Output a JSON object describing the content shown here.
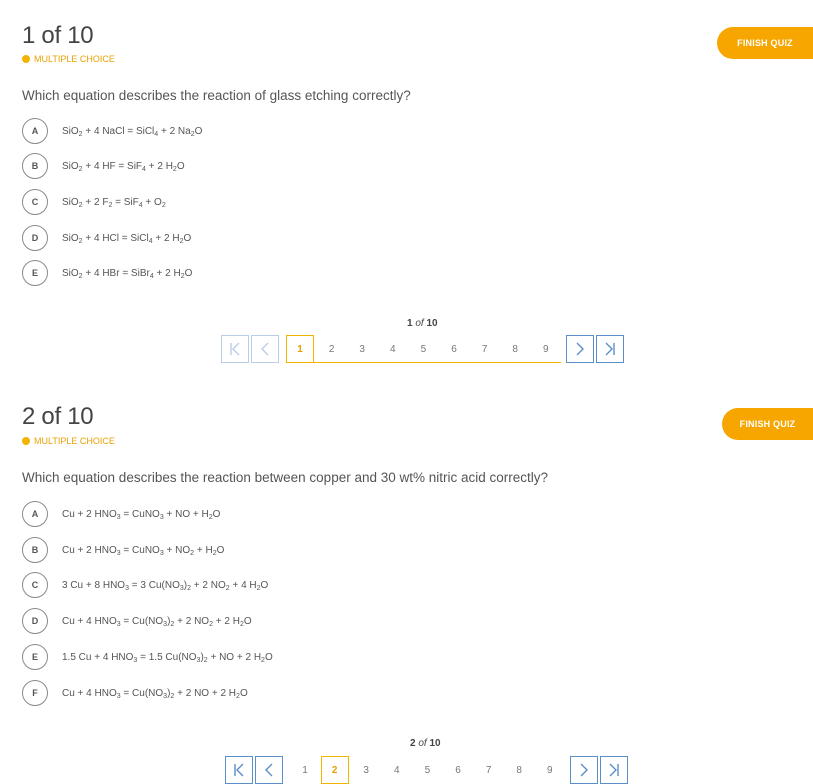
{
  "questions": [
    {
      "counter": "1 of 10",
      "type": "MULTIPLE CHOICE",
      "finish_label": "FINISH QUIZ",
      "text": "Which equation describes the reaction of glass etching correctly?",
      "options": [
        {
          "letter": "A",
          "html": "SiO<sub>2</sub> + 4 NaCl = SiCl<sub>4</sub> + 2 Na<sub>2</sub>O"
        },
        {
          "letter": "B",
          "html": "SiO<sub>2</sub> + 4 HF = SiF<sub>4</sub> + 2 H<sub>2</sub>O"
        },
        {
          "letter": "C",
          "html": "SiO<sub>2</sub> + 2 F<sub>2</sub> = SiF<sub>4</sub> + O<sub>2</sub>"
        },
        {
          "letter": "D",
          "html": "SiO<sub>2</sub> + 4 HCl = SiCl<sub>4</sub> + 2 H<sub>2</sub>O"
        },
        {
          "letter": "E",
          "html": "SiO<sub>2</sub> + 4 HBr = SiBr<sub>4</sub> + 2 H<sub>2</sub>O"
        }
      ],
      "pager": {
        "current": "1",
        "of": "of",
        "total": "10",
        "pages": [
          "1",
          "2",
          "3",
          "4",
          "5",
          "6",
          "7",
          "8",
          "9"
        ],
        "active_index": 0
      }
    },
    {
      "counter": "2 of 10",
      "type": "MULTIPLE CHOICE",
      "finish_label": "FINISH QUIZ",
      "text": "Which equation describes the reaction between copper and 30 wt% nitric acid correctly?",
      "options": [
        {
          "letter": "A",
          "html": "Cu + 2 HNO<sub>3</sub> = CuNO<sub>3</sub> + NO + H<sub>2</sub>O"
        },
        {
          "letter": "B",
          "html": "Cu + 2 HNO<sub>3</sub> = CuNO<sub>3</sub> + NO<sub>2</sub> + H<sub>2</sub>O"
        },
        {
          "letter": "C",
          "html": "3 Cu + 8 HNO<sub>3</sub> = 3 Cu(NO<sub>3</sub>)<sub>2</sub> + 2 NO<sub>2</sub> + 4 H<sub>2</sub>O"
        },
        {
          "letter": "D",
          "html": "Cu + 4 HNO<sub>3</sub> = Cu(NO<sub>3</sub>)<sub>2</sub> + 2 NO<sub>2</sub> + 2 H<sub>2</sub>O"
        },
        {
          "letter": "E",
          "html": "1.5 Cu + 4 HNO<sub>3</sub> = 1.5 Cu(NO<sub>3</sub>)<sub>2</sub> + NO + 2 H<sub>2</sub>O"
        },
        {
          "letter": "F",
          "html": "Cu + 4 HNO<sub>3</sub> = Cu(NO<sub>3</sub>)<sub>2</sub> + 2 NO + 2 H<sub>2</sub>O"
        }
      ],
      "pager": {
        "current": "2",
        "of": "of",
        "total": "10",
        "pages": [
          "1",
          "2",
          "3",
          "4",
          "5",
          "6",
          "7",
          "8",
          "9"
        ],
        "active_index": 1
      }
    }
  ],
  "icons": {
    "first": "first-page-icon",
    "prev": "previous-page-icon",
    "next": "next-page-icon",
    "last": "last-page-icon"
  },
  "colors": {
    "accent": "#f7a600",
    "type_label": "#e8a200",
    "pager_blue": "#5b8fc9",
    "pager_blue_dim": "#b9cde6"
  }
}
